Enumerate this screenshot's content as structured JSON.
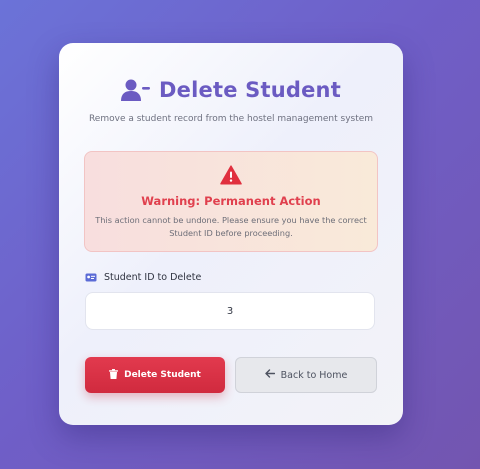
{
  "header": {
    "title": "Delete Student",
    "subtitle": "Remove a student record from the hostel management system",
    "title_icon": "user-minus-icon"
  },
  "warning": {
    "icon": "warning-triangle-icon",
    "title": "Warning: Permanent Action",
    "message": "This action cannot be undone. Please ensure you have the correct Student ID before proceeding."
  },
  "form": {
    "label": "Student ID to Delete",
    "label_icon": "id-card-icon",
    "student_id_value": "3"
  },
  "actions": {
    "delete_label": "Delete Student",
    "delete_icon": "trash-icon",
    "back_label": "Back to Home",
    "back_icon": "arrow-left-icon"
  },
  "colors": {
    "accent": "#6b5bc2",
    "danger": "#dc3545",
    "warning_text": "#e0404e"
  }
}
